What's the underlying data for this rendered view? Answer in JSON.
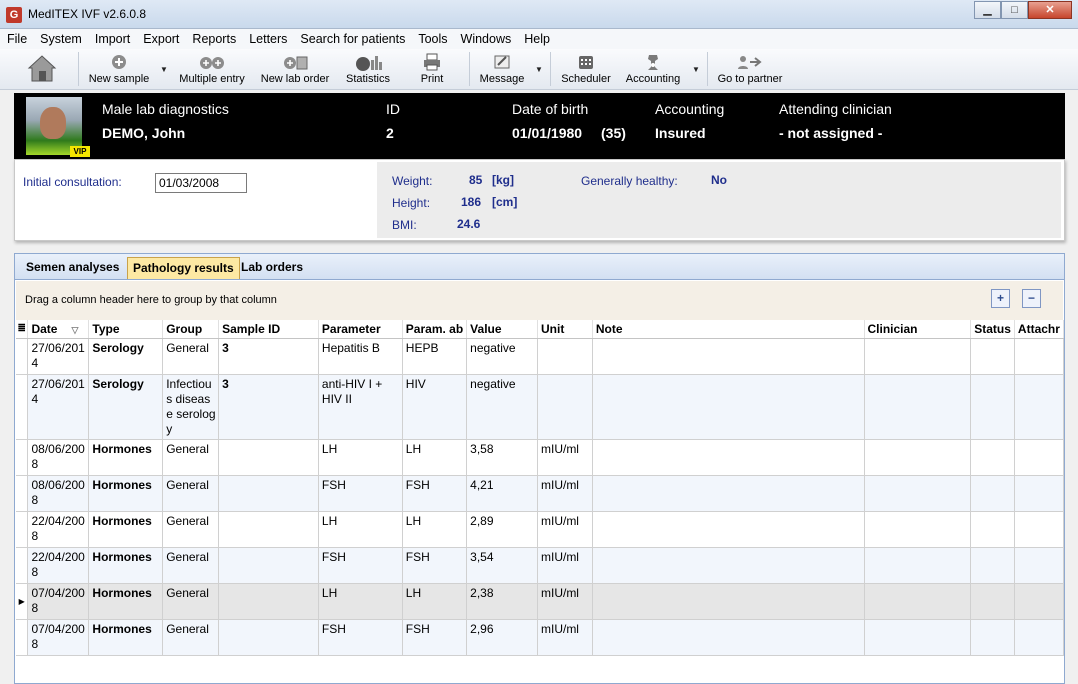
{
  "app": {
    "title": "MedITEX IVF v2.6.0.8",
    "icon": "meditex-logo-icon"
  },
  "window_controls": {
    "minimize": "▁",
    "maximize": "□",
    "close": "✕"
  },
  "menu": [
    "File",
    "System",
    "Import",
    "Export",
    "Reports",
    "Letters",
    "Search for patients",
    "Tools",
    "Windows",
    "Help"
  ],
  "toolbar": {
    "home_icon": "home-icon",
    "new_sample": "New sample",
    "multiple_entry": "Multiple entry",
    "new_lab_order": "New lab order",
    "statistics": "Statistics",
    "print": "Print",
    "message": "Message",
    "scheduler": "Scheduler",
    "accounting": "Accounting",
    "go_to_partner": "Go to partner"
  },
  "patient": {
    "section_label": "Male lab diagnostics",
    "name": "DEMO, John",
    "id_label": "ID",
    "id": "2",
    "dob_label": "Date of birth",
    "dob": "01/01/1980",
    "age": "(35)",
    "accounting_label": "Accounting",
    "accounting": "Insured",
    "clinician_label": "Attending clinician",
    "clinician": "- not assigned -",
    "vip_badge": "VIP"
  },
  "info": {
    "initial_consultation_label": "Initial consultation:",
    "initial_consultation": "01/03/2008",
    "weight_label": "Weight:",
    "weight": "85",
    "weight_unit": "[kg]",
    "height_label": "Height:",
    "height": "186",
    "height_unit": "[cm]",
    "bmi_label": "BMI:",
    "bmi": "24.6",
    "healthy_label": "Generally healthy:",
    "healthy": "No"
  },
  "tabs": [
    "Semen analyses",
    "Pathology results",
    "Lab orders"
  ],
  "active_tab": "Pathology results",
  "grid": {
    "group_hint": "Drag a column header here to group by that column",
    "expand_all": "+",
    "collapse_all": "−",
    "columns": [
      "Date",
      "Type",
      "Group",
      "Sample ID",
      "Parameter",
      "Param. ab",
      "Value",
      "Unit",
      "Note",
      "Clinician",
      "Status",
      "Attachr"
    ],
    "rows": [
      {
        "date": "27/06/2014",
        "type": "Serology",
        "group": "General",
        "sample_id": "3",
        "parameter": "Hepatitis B",
        "param_ab": "HEPB",
        "value": "negative",
        "unit": "",
        "note": "",
        "clinician": "",
        "status": "",
        "attach": ""
      },
      {
        "date": "27/06/2014",
        "type": "Serology",
        "group": "Infectious disease serology",
        "sample_id": "3",
        "parameter": "anti-HIV I + HIV II",
        "param_ab": "HIV",
        "value": "negative",
        "unit": "",
        "note": "",
        "clinician": "",
        "status": "",
        "attach": ""
      },
      {
        "date": "08/06/2008",
        "type": "Hormones",
        "group": "General",
        "sample_id": "",
        "parameter": "LH",
        "param_ab": "LH",
        "value": "3,58",
        "unit": "mIU/ml",
        "note": "",
        "clinician": "",
        "status": "",
        "attach": ""
      },
      {
        "date": "08/06/2008",
        "type": "Hormones",
        "group": "General",
        "sample_id": "",
        "parameter": "FSH",
        "param_ab": "FSH",
        "value": "4,21",
        "unit": "mIU/ml",
        "note": "",
        "clinician": "",
        "status": "",
        "attach": ""
      },
      {
        "date": "22/04/2008",
        "type": "Hormones",
        "group": "General",
        "sample_id": "",
        "parameter": "LH",
        "param_ab": "LH",
        "value": "2,89",
        "unit": "mIU/ml",
        "note": "",
        "clinician": "",
        "status": "",
        "attach": ""
      },
      {
        "date": "22/04/2008",
        "type": "Hormones",
        "group": "General",
        "sample_id": "",
        "parameter": "FSH",
        "param_ab": "FSH",
        "value": "3,54",
        "unit": "mIU/ml",
        "note": "",
        "clinician": "",
        "status": "",
        "attach": ""
      },
      {
        "date": "07/04/2008",
        "type": "Hormones",
        "group": "General",
        "sample_id": "",
        "parameter": "LH",
        "param_ab": "LH",
        "value": "2,38",
        "unit": "mIU/ml",
        "note": "",
        "clinician": "",
        "status": "",
        "attach": ""
      },
      {
        "date": "07/04/2008",
        "type": "Hormones",
        "group": "General",
        "sample_id": "",
        "parameter": "FSH",
        "param_ab": "FSH",
        "value": "2,96",
        "unit": "mIU/ml",
        "note": "",
        "clinician": "",
        "status": "",
        "attach": ""
      }
    ],
    "selected_row": 6
  },
  "colors": {
    "header_bg": "#000000",
    "label_blue": "#1f2e8c",
    "active_tab": "#fde9a3"
  }
}
